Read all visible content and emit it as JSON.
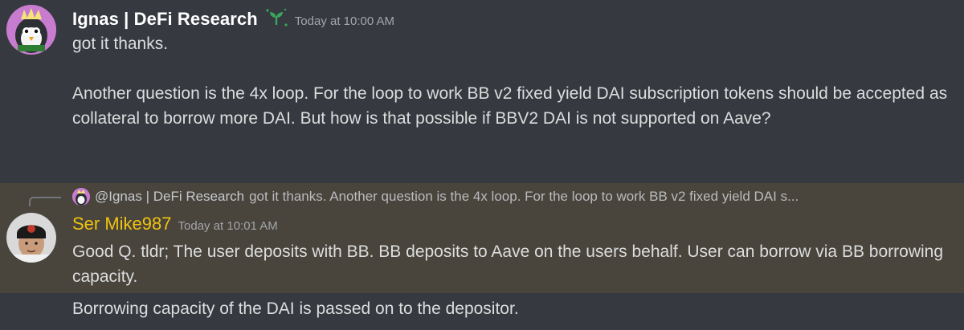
{
  "messages": {
    "first": {
      "author": "Ignas  | DeFi Research",
      "timestamp": "Today at 10:00 AM",
      "line1": "got it thanks.",
      "paragraph": "Another question is the 4x loop. For the loop to work BB v2 fixed yield DAI subscription tokens should be accepted as collateral to borrow more DAI. But how is that possible if BBV2 DAI is not supported on Aave?"
    },
    "reply": {
      "reply_to_author": "@Ignas  | DeFi Research",
      "reply_preview": "got it thanks.  Another question is the 4x loop. For the loop to work BB v2 fixed yield DAI s...",
      "author": "Ser Mike987",
      "timestamp": "Today at 10:01 AM",
      "text": "Good Q. tldr; The user deposits with BB. BB deposits to Aave on the users behalf. User can borrow via BB borrowing capacity."
    },
    "followup": {
      "text": "Borrowing capacity of the DAI is passed on to the depositor."
    }
  },
  "colors": {
    "background": "#36393f",
    "highlight": "#49443c",
    "author_reply": "#f1c40f",
    "timestamp": "#a3a6aa"
  },
  "icons": {
    "badge": "sprout-badge-icon"
  }
}
